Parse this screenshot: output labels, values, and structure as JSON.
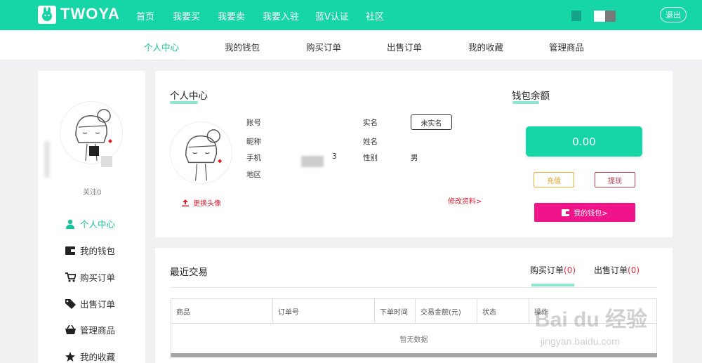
{
  "brand": {
    "name": "TWOYA"
  },
  "topnav": [
    "首页",
    "我要买",
    "我要卖",
    "我要入驻",
    "蓝V认证",
    "社区"
  ],
  "logout_label": "退出",
  "subnav": [
    "个人中心",
    "我的钱包",
    "购买订单",
    "出售订单",
    "我的收藏",
    "管理商品"
  ],
  "sidebar": {
    "follow_label": "关注0",
    "items": [
      {
        "label": "个人中心",
        "icon": "user-icon"
      },
      {
        "label": "我的钱包",
        "icon": "wallet-icon"
      },
      {
        "label": "购买订单",
        "icon": "cart-icon"
      },
      {
        "label": "出售订单",
        "icon": "tag-icon"
      },
      {
        "label": "管理商品",
        "icon": "basket-icon"
      },
      {
        "label": "我的收藏",
        "icon": "star-icon"
      }
    ]
  },
  "profile": {
    "title": "个人中心",
    "change_avatar": "更换头像",
    "labels": {
      "account": "账号",
      "nickname": "昵称",
      "phone": "手机",
      "region": "地区",
      "realname": "实名",
      "name": "姓名",
      "gender": "性别"
    },
    "phone_tail": "3",
    "gender_value": "男",
    "realname_status": "未实名",
    "edit_link": "修改资料>"
  },
  "wallet": {
    "title": "钱包余额",
    "balance": "0.00",
    "charge": "充值",
    "withdraw": "提现",
    "my_wallet": "我的钱包>"
  },
  "transactions": {
    "title": "最近交易",
    "tab_buy": "购买订单",
    "tab_buy_count": "(0)",
    "tab_sell": "出售订单",
    "tab_sell_count": "(0)",
    "columns": [
      "商品",
      "订单号",
      "下单时间",
      "交易金额(元)",
      "状态",
      "操作"
    ],
    "empty": "暂无数据"
  },
  "watermark": {
    "main": "Bai du 经验",
    "sub": "jingyan.baidu.com"
  },
  "colors": {
    "primary": "#16d5a6",
    "accent_pink": "#f0148a",
    "danger": "#d23"
  }
}
